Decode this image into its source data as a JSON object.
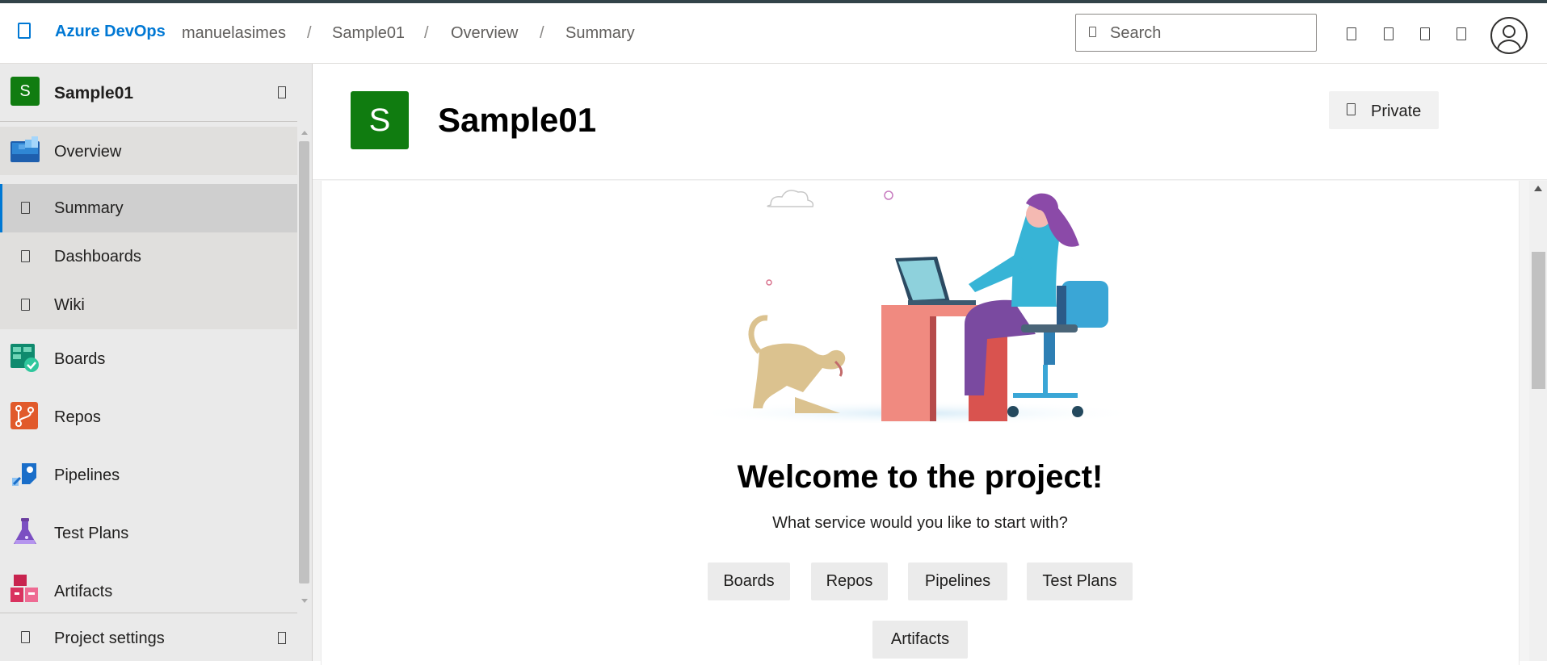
{
  "header": {
    "brand": "Azure DevOps",
    "breadcrumb": [
      "manuelasimes",
      "Sample01",
      "Overview",
      "Summary"
    ],
    "separator": "/",
    "search_placeholder": "Search"
  },
  "sidebar": {
    "project_initial": "S",
    "project_name": "Sample01",
    "overview_label": "Overview",
    "overview_subitems": [
      "Summary",
      "Dashboards",
      "Wiki"
    ],
    "selected_subitem": "Summary",
    "services": [
      "Boards",
      "Repos",
      "Pipelines",
      "Test Plans",
      "Artifacts"
    ],
    "settings_label": "Project settings"
  },
  "project_header": {
    "initial": "S",
    "name": "Sample01",
    "visibility": "Private"
  },
  "welcome": {
    "title": "Welcome to the project!",
    "subtitle": "What service would you like to start with?",
    "services": [
      "Boards",
      "Repos",
      "Pipelines",
      "Test Plans",
      "Artifacts"
    ]
  },
  "colors": {
    "accent": "#0078d4",
    "project_tile": "#107c10",
    "sidebar_bg": "#eaeaea"
  },
  "icons": {
    "logo": "azure-devops-logo-icon",
    "header_actions": [
      "work-items-icon",
      "shopping-bag-icon",
      "help-icon",
      "user-settings-icon"
    ],
    "overview": "overview-icon",
    "boards": "boards-icon",
    "repos": "repos-icon",
    "pipelines": "pipelines-icon",
    "test_plans": "test-plans-icon",
    "artifacts": "artifacts-icon"
  }
}
